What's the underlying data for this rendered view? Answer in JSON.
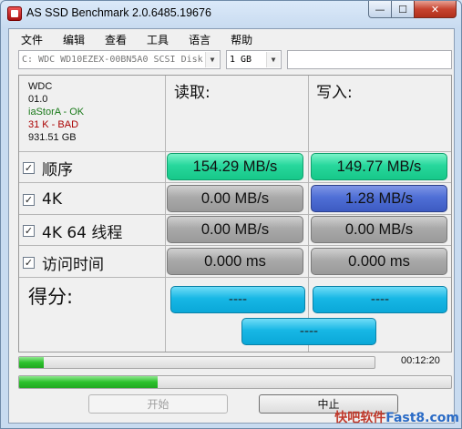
{
  "window": {
    "title": "AS SSD Benchmark 2.0.6485.19676",
    "buttons": {
      "minimize": "—",
      "maximize": "☐",
      "close": "✕"
    }
  },
  "menu": [
    "文件",
    "编辑",
    "查看",
    "工具",
    "语言",
    "帮助"
  ],
  "toolbar": {
    "drive_select": "C: WDC WD10EZEX-00BN5A0 SCSI Disk",
    "size_select": "1 GB",
    "extra_field": ""
  },
  "drive_info": {
    "vendor": "WDC",
    "firmware": "01.0",
    "driver": "iaStorA - OK",
    "alignment": "31 K - BAD",
    "capacity": "931.51 GB"
  },
  "columns": {
    "read": "读取:",
    "write": "写入:"
  },
  "tests": [
    {
      "label": "顺序",
      "checked": true,
      "read": "154.29 MB/s",
      "write": "149.77 MB/s",
      "read_color": "#27d79c",
      "write_color": "#27d79c"
    },
    {
      "label": "4K",
      "checked": true,
      "read": "0.00 MB/s",
      "write": "1.28 MB/s",
      "read_color": "#a9a9a9",
      "write_color": "#4f6fd6"
    },
    {
      "label": "4K 64 线程",
      "checked": true,
      "read": "0.00 MB/s",
      "write": "0.00 MB/s",
      "read_color": "#a9a9a9",
      "write_color": "#a9a9a9"
    },
    {
      "label": "访问时间",
      "checked": true,
      "read": "0.000 ms",
      "write": "0.000 ms",
      "read_color": "#a9a9a9",
      "write_color": "#a9a9a9"
    }
  ],
  "score": {
    "label": "得分:",
    "read": "----",
    "write": "----",
    "total": "----"
  },
  "progress": {
    "test_progress": 0.07,
    "overall_progress": 0.32,
    "elapsed": "00:12:20"
  },
  "buttons": {
    "start": "开始",
    "stop": "中止"
  },
  "watermark": {
    "part1": "快吧软件",
    "part2": "Fast8.com"
  }
}
